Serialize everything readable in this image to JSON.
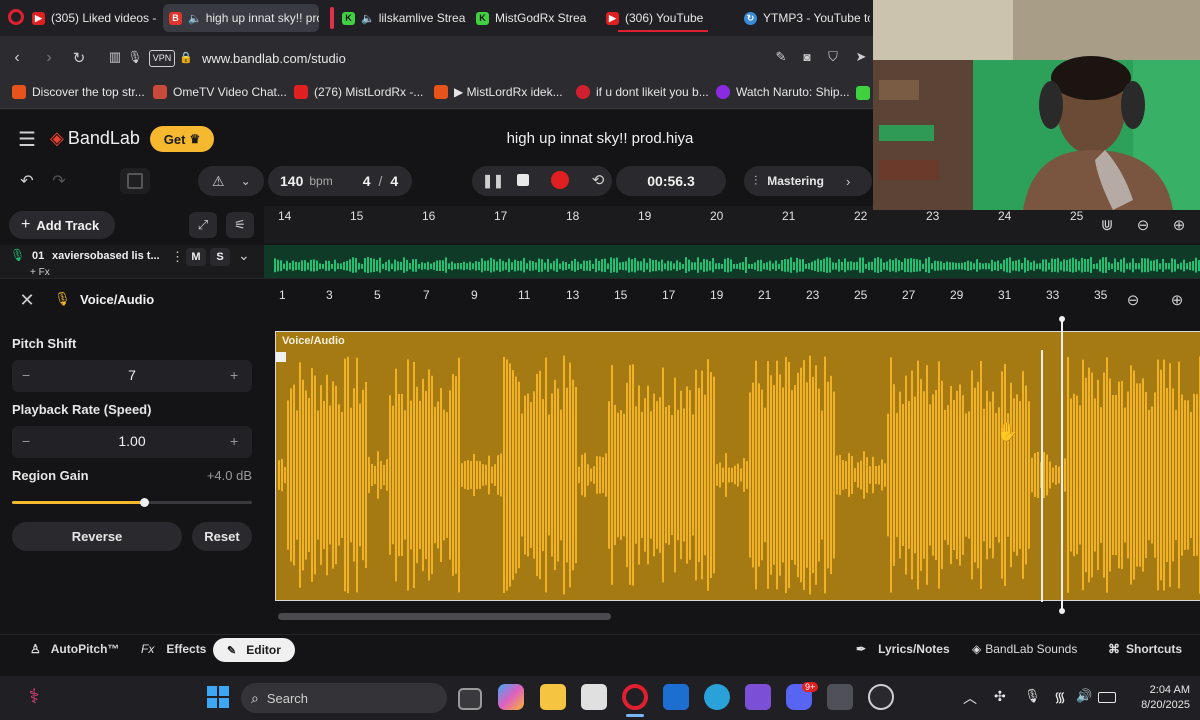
{
  "browser": {
    "tabs": [
      {
        "label": "(305) Liked videos - ",
        "fav_color": "#e02020",
        "fav": "▶"
      },
      {
        "label": "high up innat sky!! pro",
        "fav_color": "#e0342c",
        "fav": "B",
        "active": true
      },
      {
        "label": "lilskamlive Stream",
        "fav_color": "#3fd13f",
        "fav": "K"
      },
      {
        "label": "MistGodRx Strea",
        "fav_color": "#3fd13f",
        "fav": "K"
      },
      {
        "label": "(306) YouTube",
        "fav_color": "#e02020",
        "fav": "▶"
      },
      {
        "label": "YTMP3 - YouTube to",
        "fav_color": "#3a8bd8",
        "fav": "↻"
      }
    ],
    "url": "www.bandlab.com/studio",
    "vpn_label": "VPN",
    "bookmarks": [
      {
        "label": "Discover the top str...",
        "color": "#e8531c"
      },
      {
        "label": "OmeTV Video Chat...",
        "color": "#c94a3a"
      },
      {
        "label": "(276) MistLordRx -...",
        "color": "#e02020"
      },
      {
        "label": "▶ MistLordRx idek...",
        "color": "#e8531c"
      },
      {
        "label": "if u dont likeit you b...",
        "color": "#d02030"
      },
      {
        "label": "Watch Naruto: Ship...",
        "color": "#8a2be2"
      }
    ]
  },
  "app": {
    "brand": "BandLab",
    "get_label": "Get",
    "project_title": "high up innat sky!! prod.hiya",
    "bpm_value": "140",
    "bpm_unit": "bpm",
    "time_sig_num": "4",
    "time_sig_sep": "/",
    "time_sig_den": "4",
    "time_display": "00:56.3",
    "mastering_label": "Mastering",
    "add_track_label": "Add Track",
    "top_ruler": [
      "14",
      "15",
      "16",
      "17",
      "18",
      "19",
      "20",
      "21",
      "22",
      "23",
      "24",
      "25"
    ],
    "track": {
      "number": "01",
      "name": "xaviersobased lis t...",
      "fx": "+ Fx",
      "mute": "M",
      "solo": "S"
    },
    "editor_title": "Voice/Audio",
    "editor_ruler": [
      "1",
      "3",
      "5",
      "7",
      "9",
      "11",
      "13",
      "15",
      "17",
      "19",
      "21",
      "23",
      "25",
      "27",
      "29",
      "31",
      "33",
      "35"
    ],
    "region_label": "Voice/Audio",
    "pitch_shift": {
      "label": "Pitch Shift",
      "value": "7"
    },
    "playback_rate": {
      "label": "Playback Rate (Speed)",
      "value": "1.00"
    },
    "region_gain": {
      "label": "Region Gain",
      "value": "+4.0 dB",
      "level": 0.55
    },
    "reverse_label": "Reverse",
    "reset_label": "Reset",
    "bottom": {
      "autopitch": "AutoPitch™",
      "effects_prefix": "Fx",
      "effects": "Effects",
      "editor": "Editor",
      "lyrics": "Lyrics/Notes",
      "sounds": "BandLab Sounds",
      "shortcuts": "Shortcuts"
    }
  },
  "taskbar": {
    "search_placeholder": "Search",
    "time": "2:04 AM",
    "date": "8/20/2025",
    "badge": "9+"
  },
  "colors": {
    "accent": "#f5b82e",
    "waveform": "#f0b125",
    "region_bg": "#a57a13",
    "record": "#e02020",
    "track_green": "#20c073"
  }
}
